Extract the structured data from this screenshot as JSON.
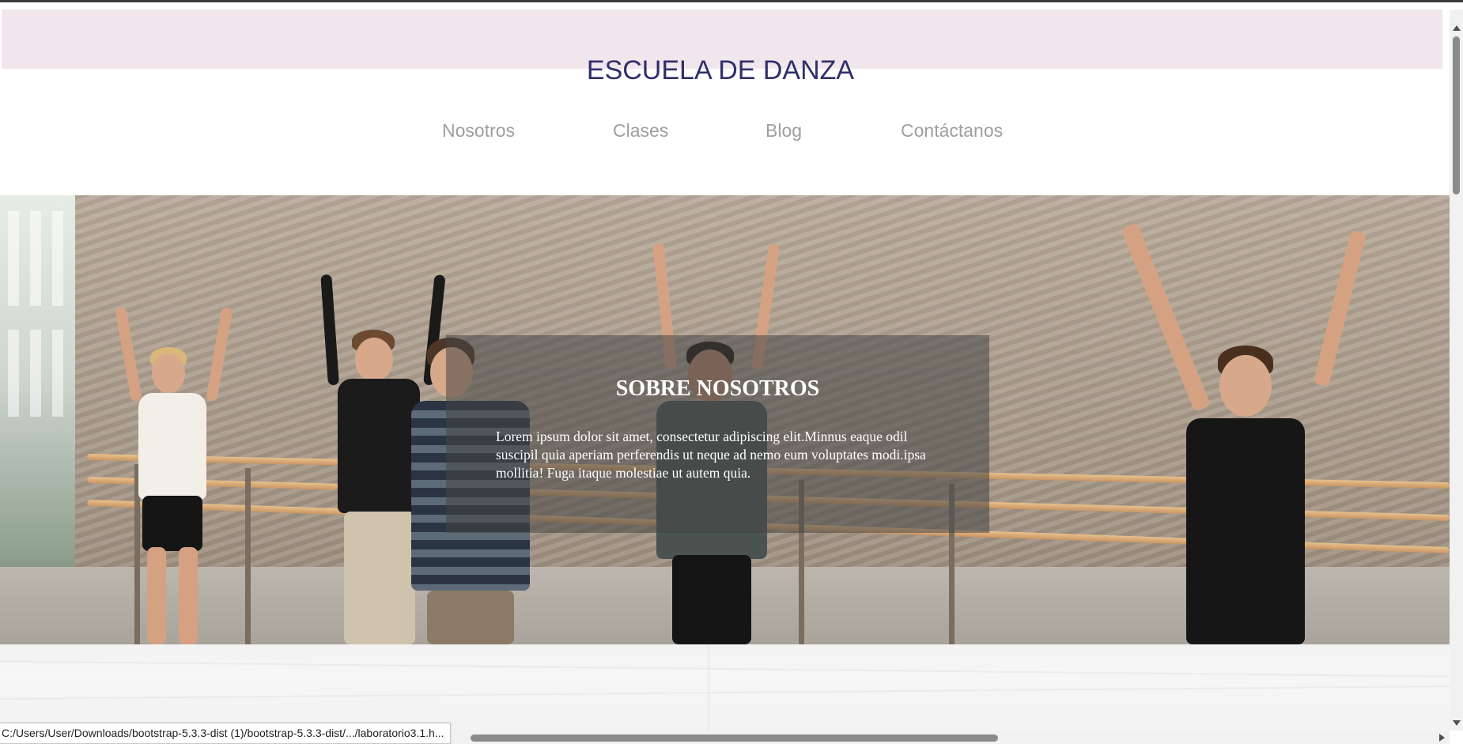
{
  "header": {
    "title": "ESCUELA DE DANZA"
  },
  "nav": {
    "items": [
      {
        "label": "Nosotros"
      },
      {
        "label": "Clases"
      },
      {
        "label": "Blog"
      },
      {
        "label": "Contáctanos"
      }
    ]
  },
  "hero": {
    "image": "dance-class-photo",
    "card": {
      "title": "SOBRE NOSOTROS",
      "text": "Lorem ipsum dolor sit amet, consectetur adipiscing elit.Minnus eaque odil suscipil quia aperiam perferendis ut neque ad nemo eum voluptates modi.ipsa mollitia! Fuga itaque molestiae ut autem quia."
    }
  },
  "browser": {
    "status_url": "C:/Users/User/Downloads/bootstrap-5.3.3-dist (1)/bootstrap-5.3.3-dist/.../laboratorio3.1.h..."
  },
  "colors": {
    "header_band": "#f1e6ec",
    "title": "#2f2f6b",
    "nav_link": "#9e9e9e",
    "overlay": "rgba(70,70,70,0.55)"
  }
}
